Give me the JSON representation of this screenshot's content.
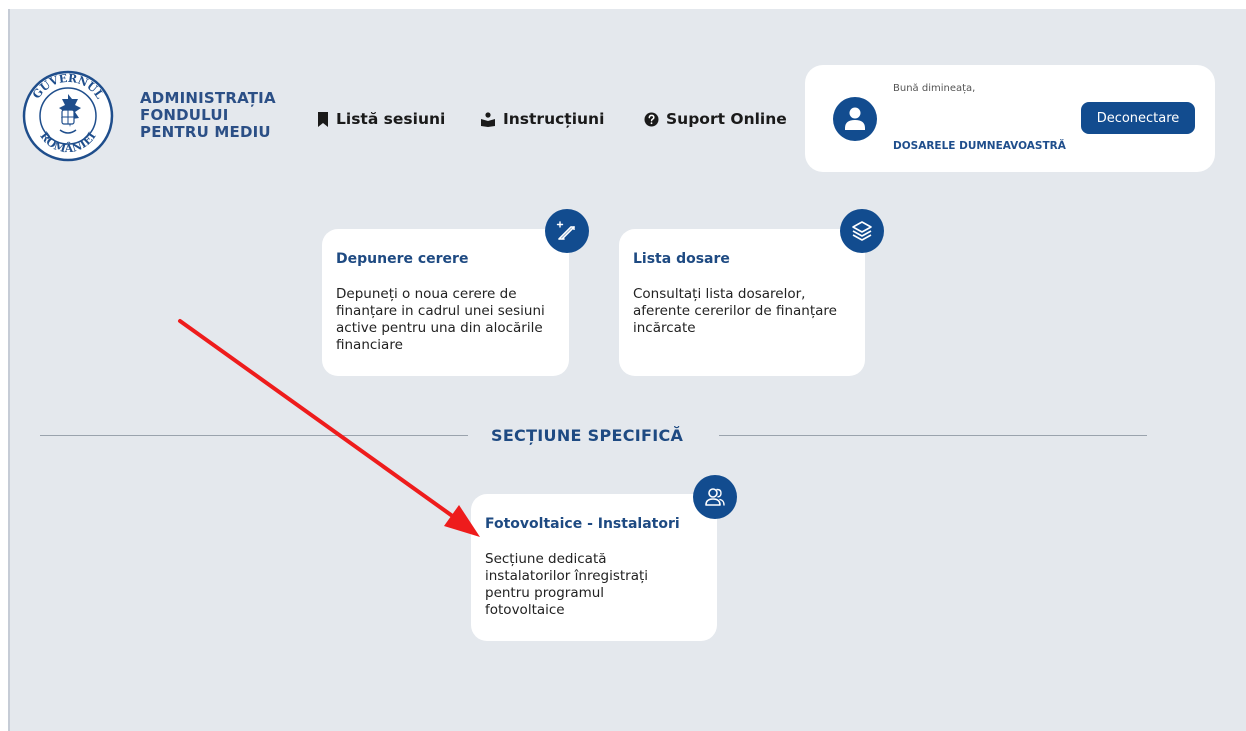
{
  "brand": {
    "lines": [
      "ADMINISTRAȚIA",
      "FONDULUI",
      "PENTRU MEDIU"
    ],
    "logo_text_top": "GUVERNUL",
    "logo_text_bottom": "ROMÂNIEI"
  },
  "nav": {
    "sessions_label": "Listă sesiuni",
    "instructions_label": "Instrucțiuni",
    "support_label": "Suport Online"
  },
  "user": {
    "greeting": "Bună dimineața,",
    "dossiers_link": "DOSARELE DUMNEAVOASTRĂ",
    "logout_label": "Deconectare"
  },
  "cards": {
    "submit": {
      "title": "Depunere cerere",
      "description": "Depuneți o noua cerere de finanțare in cadrul unei sesiuni active pentru una din alocările financiare",
      "icon": "edit-icon"
    },
    "list": {
      "title": "Lista dosare",
      "description": "Consultați lista dosarelor, aferente cererilor de finanțare incărcate",
      "icon": "layers-icon"
    }
  },
  "section": {
    "title": "SECȚIUNE SPECIFICĂ"
  },
  "specific_cards": {
    "pv": {
      "title": "Fotovoltaice - Instalatori",
      "description": "Secțiune dedicată instalatorilor înregistrați pentru programul fotovoltaice",
      "icon": "users-icon"
    }
  },
  "colors": {
    "primary": "#124c8f",
    "brand_text": "#2b4f86",
    "background": "#e4e8ed",
    "annotation_arrow": "#ee1c1c"
  }
}
